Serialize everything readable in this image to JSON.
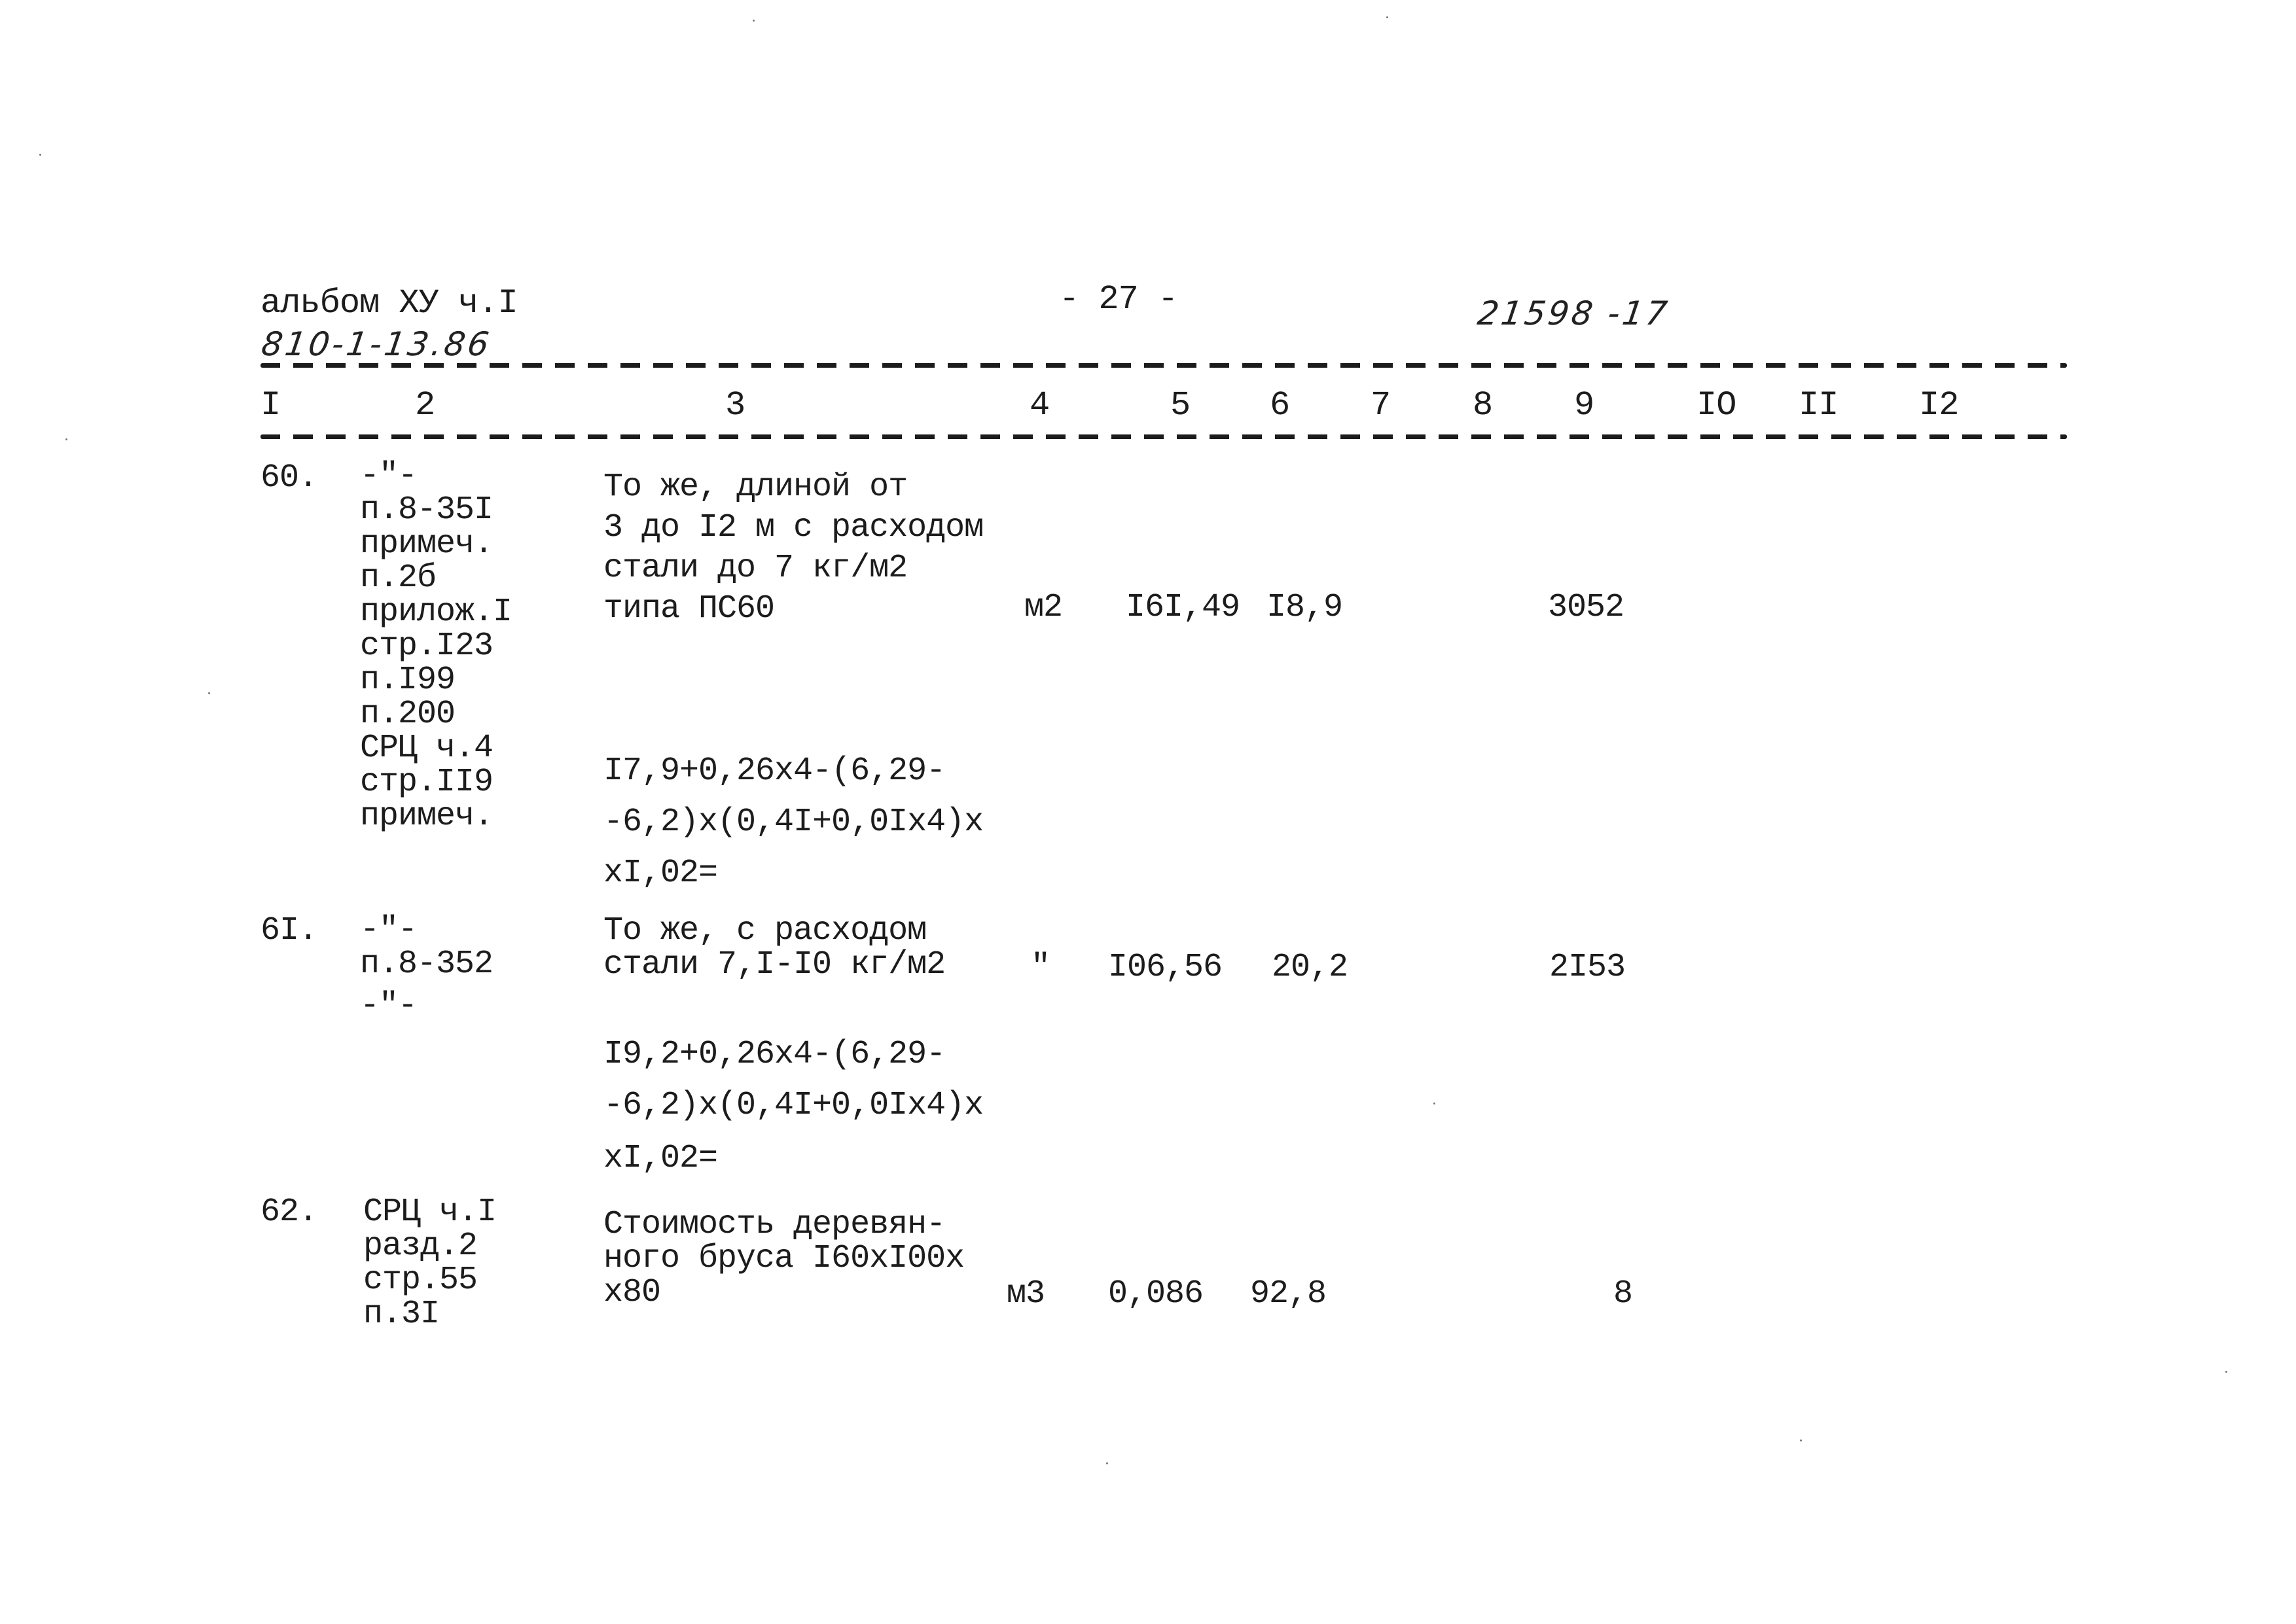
{
  "header": {
    "album": "альбом ХУ ч.I",
    "album_code": "810-1-13.86",
    "page_number": "- 27 -",
    "document_number": "21598 -17"
  },
  "columns": [
    "I",
    "2",
    "3",
    "4",
    "5",
    "6",
    "7",
    "8",
    "9",
    "IO",
    "II",
    "I2"
  ],
  "rows": [
    {
      "num": "60.",
      "refs": [
        "-\"-",
        "п.8-35I",
        "примеч.",
        "п.2б",
        "прилож.I",
        "стр.I23",
        "п.I99",
        "п.200",
        "СРЦ ч.4",
        "стр.II9",
        "примеч."
      ],
      "description": [
        "То же, длиной от",
        "3 до I2 м с расходом",
        "стали до 7 кг/м2",
        "типа ПС60"
      ],
      "calculation": [
        "I7,9+0,26x4-(6,29-",
        "-6,2)x(0,4I+0,0Ix4)x",
        "xI,02="
      ],
      "unit": "м2",
      "col5": "I6I,49",
      "col6": "I8,9",
      "col9": "3052"
    },
    {
      "num": "6I.",
      "refs": [
        "-\"-",
        "п.8-352",
        "-\"-"
      ],
      "description": [
        "То же, с расходом",
        "стали 7,I-I0 кг/м2"
      ],
      "calculation": [
        "I9,2+0,26x4-(6,29-",
        "-6,2)x(0,4I+0,0Ix4)x",
        "xI,02="
      ],
      "unit": "\"",
      "col5": "I06,56",
      "col6": "20,2",
      "col9": "2I53"
    },
    {
      "num": "62.",
      "refs": [
        "СРЦ ч.I",
        "разд.2",
        "стр.55",
        "п.3I"
      ],
      "description": [
        "Стоимость деревян-",
        "ного бруса I60xI00x",
        "x80"
      ],
      "unit": "м3",
      "col5": "0,086",
      "col6": "92,8",
      "col9": "8"
    }
  ]
}
